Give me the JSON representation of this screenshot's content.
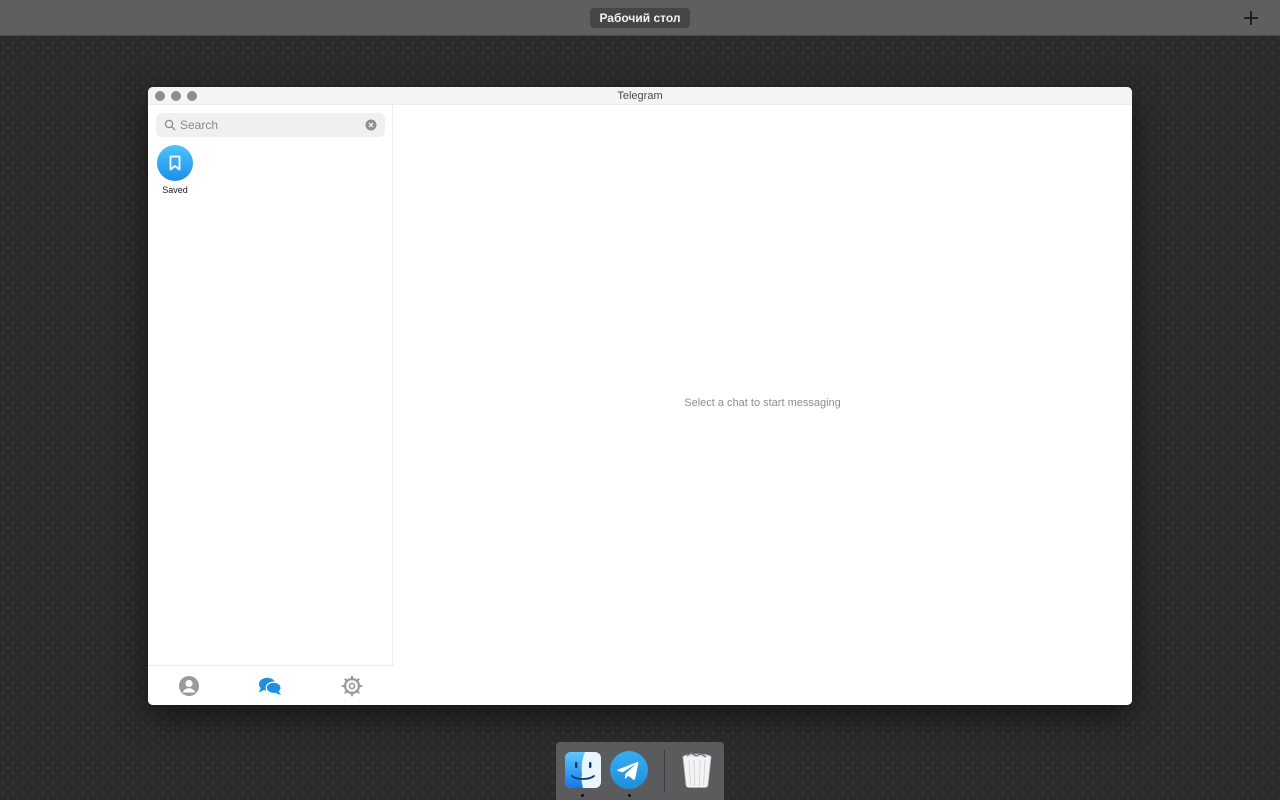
{
  "top_bar": {
    "desktop_label": "Рабочий стол",
    "add_icon": "plus-icon"
  },
  "window": {
    "title": "Telegram",
    "search": {
      "placeholder": "Search",
      "value": ""
    },
    "chats": [
      {
        "label": "Saved",
        "icon": "bookmark-icon",
        "accent": "#2aa3ef"
      }
    ],
    "bottom_tabs": [
      {
        "name": "contacts",
        "icon": "person-circle-icon",
        "active": false
      },
      {
        "name": "chats",
        "icon": "chat-bubbles-icon",
        "active": true
      },
      {
        "name": "settings",
        "icon": "gear-icon",
        "active": false
      }
    ],
    "empty_message": "Select a chat to start messaging"
  },
  "dock": {
    "items": [
      {
        "name": "finder",
        "icon": "finder-icon",
        "running": true
      },
      {
        "name": "telegram",
        "icon": "telegram-icon",
        "running": true
      },
      {
        "name": "trash",
        "icon": "trash-icon",
        "running": false
      }
    ]
  },
  "colors": {
    "accent": "#1e8fe1",
    "desktop_bg": "#2a2a2c",
    "top_bar": "#5f5f62"
  }
}
